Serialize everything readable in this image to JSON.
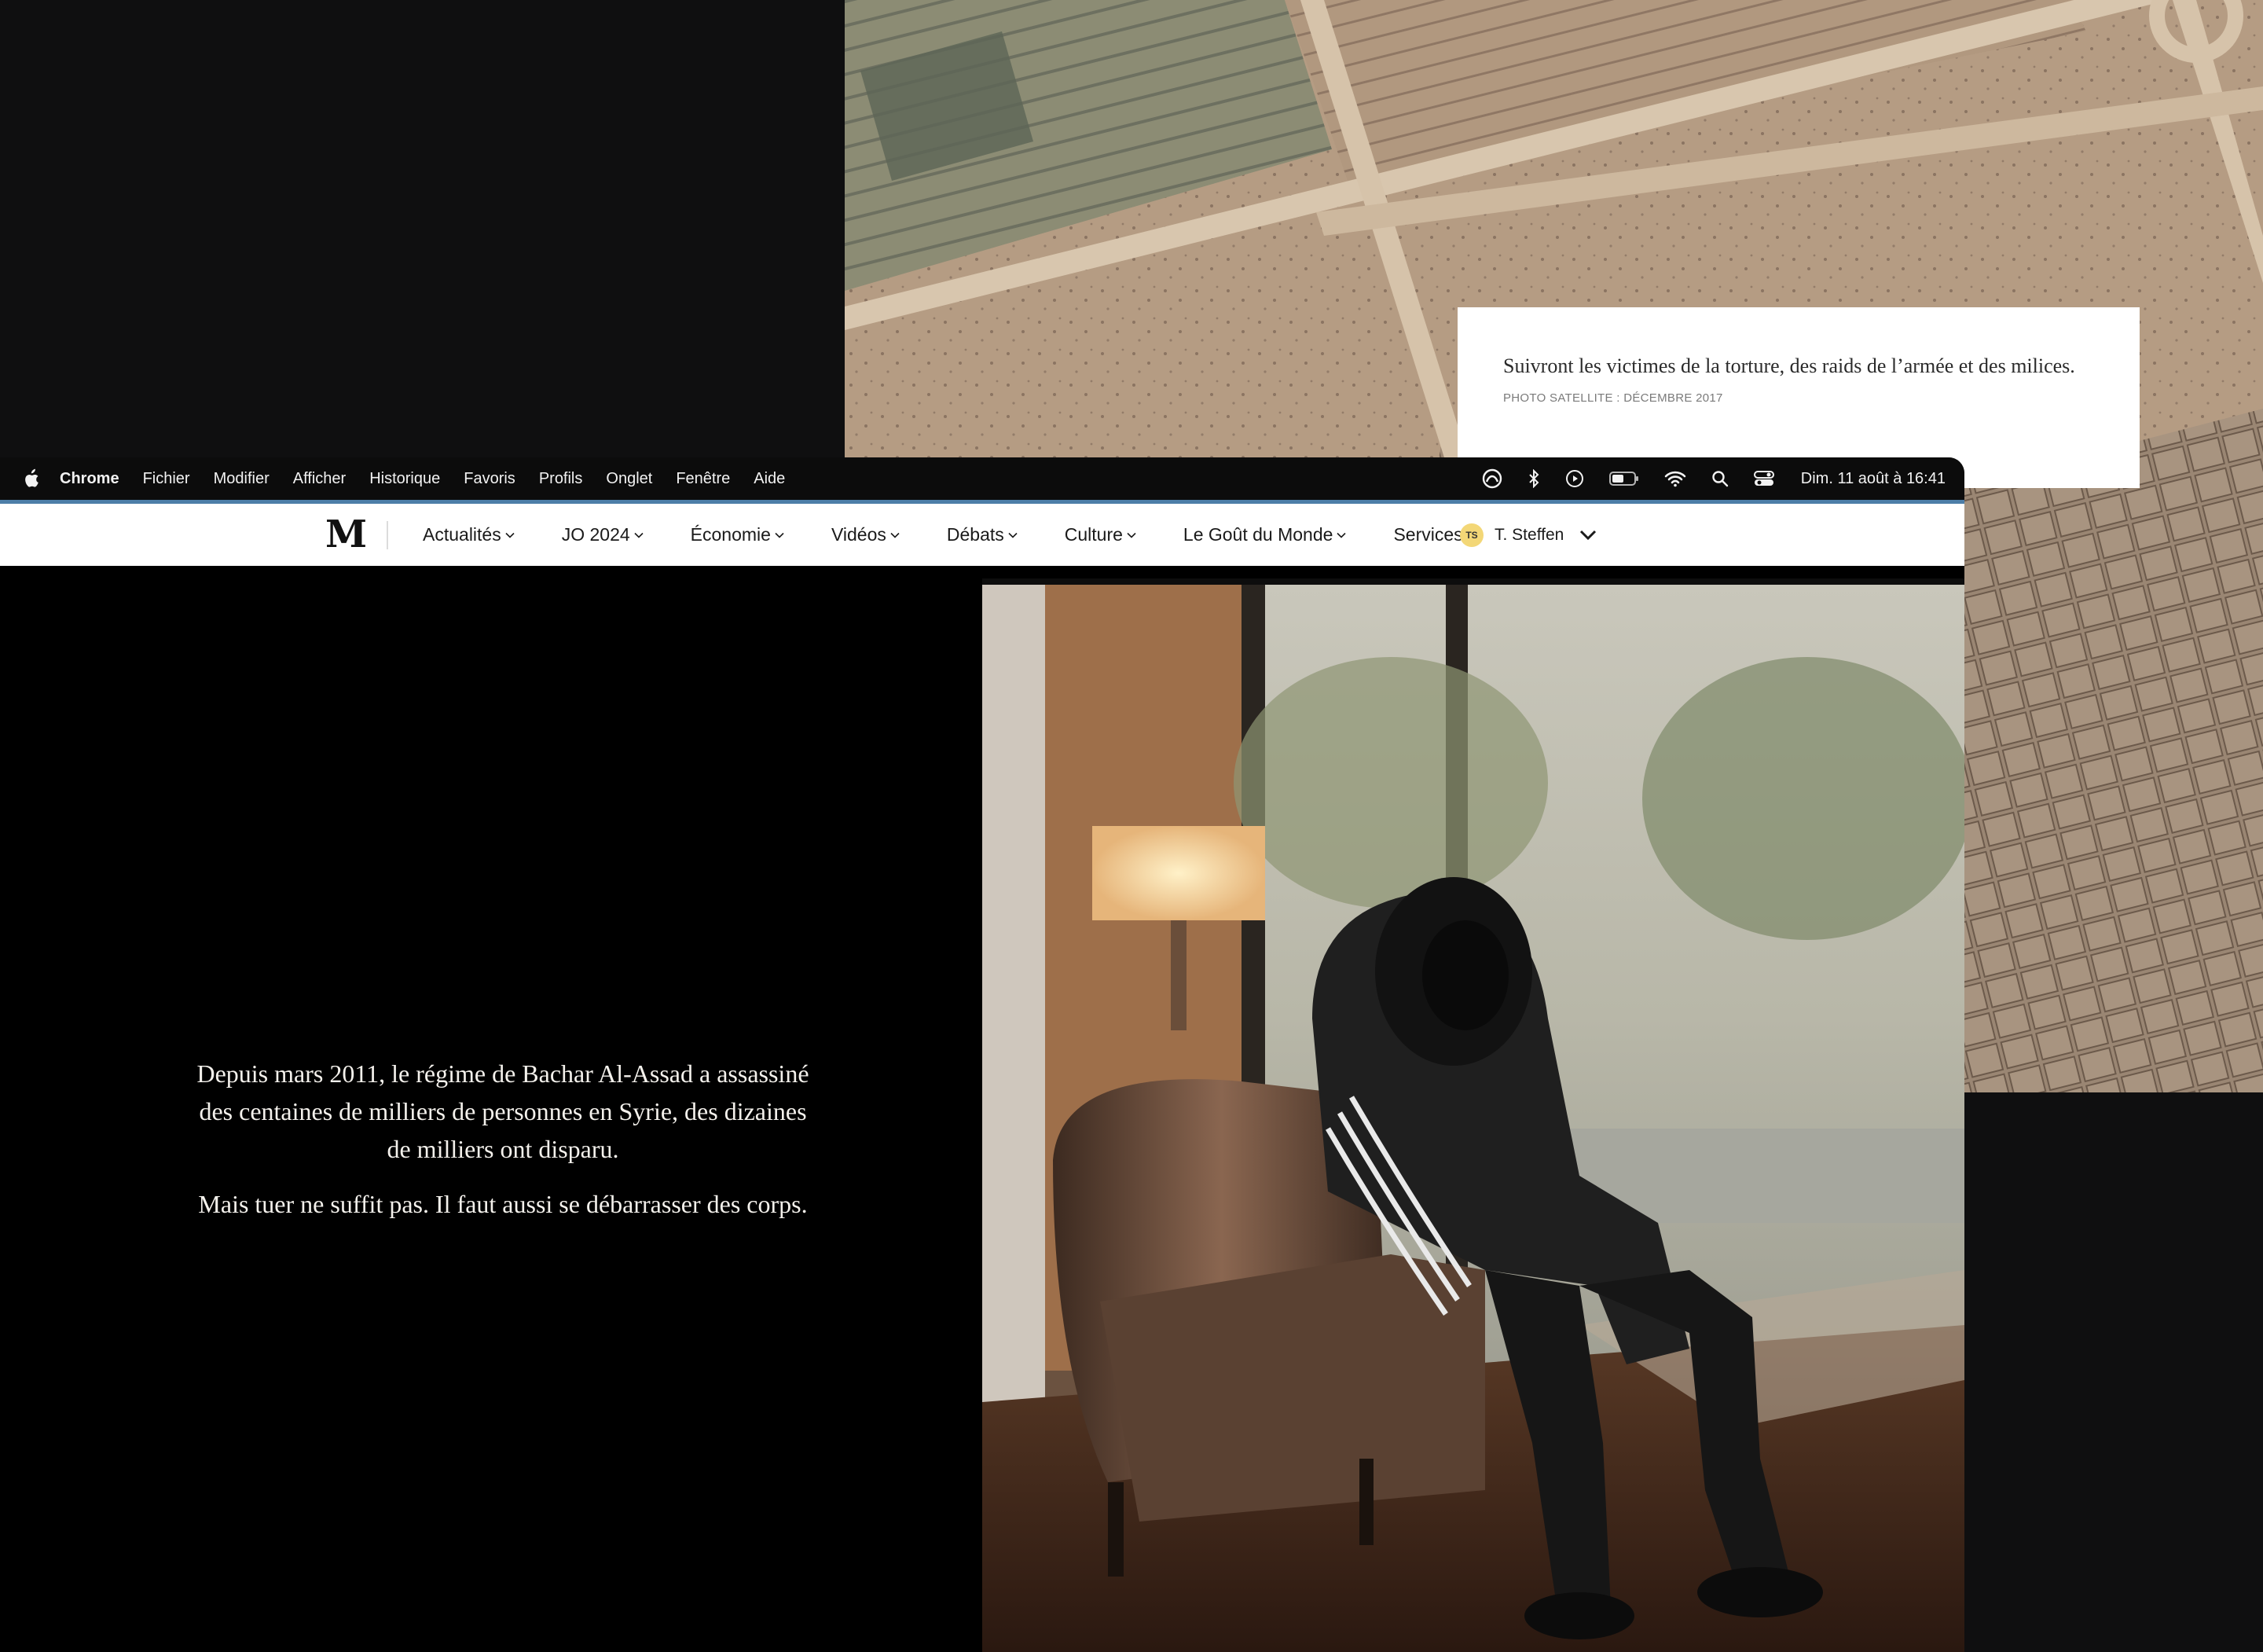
{
  "background_article": {
    "caption_text": "Suivront les victimes de la torture, des raids de l’armée et des milices.",
    "caption_credit": "PHOTO SATELLITE : DÉCEMBRE 2017",
    "image_icon": "satellite-photo"
  },
  "menubar": {
    "apple_icon": "apple-icon",
    "app_name": "Chrome",
    "items": [
      "Fichier",
      "Modifier",
      "Afficher",
      "Historique",
      "Favoris",
      "Profils",
      "Onglet",
      "Fenêtre",
      "Aide"
    ],
    "status_icons": [
      "creative-cloud-icon",
      "bluetooth-icon",
      "play-icon",
      "battery-icon",
      "wifi-icon",
      "search-icon",
      "control-center-icon"
    ],
    "clock": "Dim. 11 août à  16:41"
  },
  "site_nav": {
    "logo": "M",
    "items": [
      {
        "label": "Actualités"
      },
      {
        "label": "JO 2024"
      },
      {
        "label": "Économie"
      },
      {
        "label": "Vidéos"
      },
      {
        "label": "Débats"
      },
      {
        "label": "Culture"
      },
      {
        "label": "Le Goût du Monde"
      },
      {
        "label": "Services"
      }
    ],
    "user_initials": "TS",
    "user_name": "T. Steffen"
  },
  "article": {
    "paragraphs": [
      "Depuis mars 2011, le régime de Bachar Al-Assad a assassiné des centaines de milliers de personnes en Syrie, des dizaines de milliers ont disparu.",
      "Mais tuer ne suffit pas. Il faut aussi se débarrasser des corps."
    ],
    "photo_icon": "portrait-photo"
  },
  "colors": {
    "accent": "#4d7ea8",
    "page_background": "#000000",
    "desktop_background": "#0f0f10"
  }
}
